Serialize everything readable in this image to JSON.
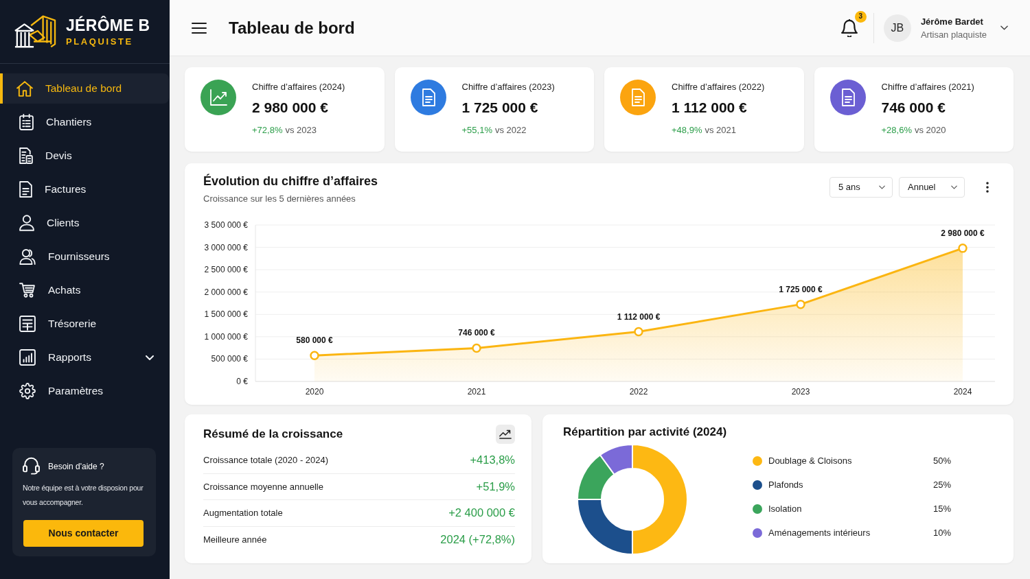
{
  "sidebar": {
    "brand": {
      "name": "JÉRÔME B",
      "tagline": "PLAQUISTE"
    },
    "items": [
      {
        "label": "Tableau de bord",
        "selected": true
      },
      {
        "label": "Chantiers",
        "selected": false
      },
      {
        "label": "Devis",
        "selected": false
      },
      {
        "label": "Factures",
        "selected": false
      },
      {
        "label": "Clients",
        "selected": false
      },
      {
        "label": "Fournisseurs",
        "selected": false
      },
      {
        "label": "Achats",
        "selected": false
      },
      {
        "label": "Trésorerie",
        "selected": false
      },
      {
        "label": "Rapports",
        "selected": false,
        "expanded": false
      },
      {
        "label": "Paramètres",
        "selected": false
      }
    ],
    "help": {
      "title": "Besoin d'aide ?",
      "text": "Notre équipe est à votre disposion pour vous accompagner.",
      "button": "Nous contacter"
    }
  },
  "header": {
    "title": "Tableau de bord",
    "notifications": "3",
    "user": {
      "initials": "JB",
      "name": "Jérôme Bardet",
      "role": "Artisan plaquiste"
    }
  },
  "stats": [
    {
      "label": "Chiffre d’affaires (2024)",
      "value": "2 980 000 €",
      "change": "+72,8%",
      "comparison": "vs 2023",
      "color": "#3aa354"
    },
    {
      "label": "Chiffre d’affaires (2023)",
      "value": "1 725 000 €",
      "change": "+55,1%",
      "comparison": "vs 2022",
      "color": "#2e7be0"
    },
    {
      "label": "Chiffre d’affaires (2022)",
      "value": "1 112 000 €",
      "change": "+48,9%",
      "comparison": "vs 2021",
      "color": "#fba40f"
    },
    {
      "label": "Chiffre d’affaires (2021)",
      "value": "746 000 €",
      "change": "+28,6%",
      "comparison": "vs 2020",
      "color": "#6b5fd3"
    }
  ],
  "revenue_chart": {
    "subtitle": "Croissance sur les 5 dernières années",
    "filters": [
      {
        "value": "5 ans"
      },
      {
        "value": "Annuel"
      }
    ],
    "chart_data": {
      "type": "area",
      "title": "Évolution du chiffre d’affaires",
      "categories": [
        "2020",
        "2021",
        "2022",
        "2023",
        "2024"
      ],
      "series": [
        {
          "color": "#fbb511",
          "values": [
            580000,
            746000,
            1112000,
            1725000,
            2980000
          ]
        }
      ],
      "ylim": [
        0,
        3500000
      ],
      "yticks": [
        {
          "value": 0,
          "label": "0 €"
        },
        {
          "value": 500000,
          "label": "500 000 €"
        },
        {
          "value": 1000000,
          "label": "1 000 000 €"
        },
        {
          "value": 1500000,
          "label": "1 500 000 €"
        },
        {
          "value": 2000000,
          "label": "2 000 000 €"
        },
        {
          "value": 2500000,
          "label": "2 500 000 €"
        },
        {
          "value": 3000000,
          "label": "3 000 000 €"
        },
        {
          "value": 3500000,
          "label": "3 500 000 €"
        }
      ],
      "grid": true,
      "value_labels": [
        "580 000 €",
        "746 000 €",
        "1 112 000 €",
        "1 725 000 €",
        "2 980 000 €"
      ]
    }
  },
  "growth_summary": {
    "title": "Résumé de la croissance",
    "rows": [
      {
        "label": "Croissance totale (2020 - 2024)",
        "value": "+413,8%"
      },
      {
        "label": "Croissance moyenne annuelle",
        "value": "+51,9%"
      },
      {
        "label": "Augmentation totale",
        "value": "+2 400 000 €"
      },
      {
        "label": "Meilleure année",
        "value": "2024 (+72,8%)"
      }
    ]
  },
  "activity_split": {
    "chart_data": {
      "type": "donut",
      "title": "Répartition par activité (2024)",
      "categories": [
        "Doublage & Cloisons",
        "Plafonds",
        "Isolation",
        "Aménagements intérieurs"
      ],
      "series": [
        {
          "values": [
            50,
            25,
            15,
            10
          ]
        }
      ],
      "colors": [
        "#fdb813",
        "#1c4f8c",
        "#3ba55c",
        "#7b6ad8"
      ],
      "value_labels": [
        "50%",
        "25%",
        "15%",
        "10%"
      ]
    }
  }
}
